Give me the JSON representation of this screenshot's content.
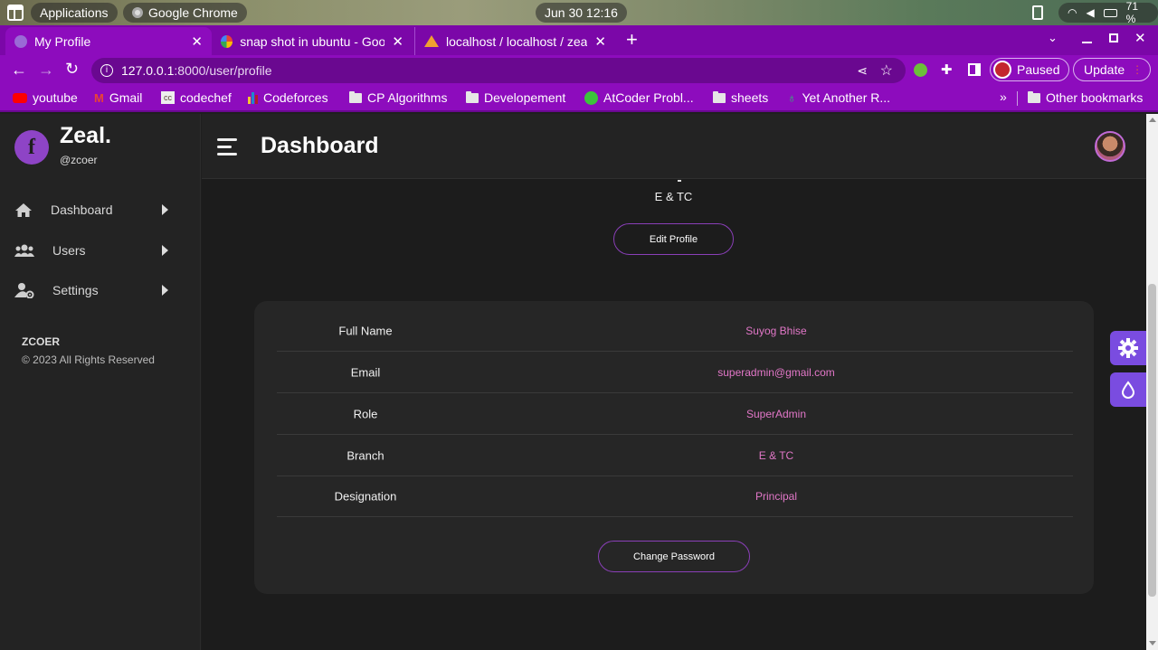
{
  "os": {
    "applications": "Applications",
    "active_app": "Google Chrome",
    "datetime": "Jun 30  12:16",
    "battery": "71 %"
  },
  "tabs": [
    {
      "title": "My Profile"
    },
    {
      "title": "snap shot in ubuntu - Goo"
    },
    {
      "title": "localhost / localhost / zea"
    }
  ],
  "toolbar": {
    "url_host": "127.0.0.1",
    "url_rest": ":8000/user/profile",
    "paused": "Paused",
    "update": "Update"
  },
  "bookmarks": [
    "youtube",
    "Gmail",
    "codechef",
    "Codeforces",
    "CP Algorithms",
    "Developement",
    "AtCoder Probl...",
    "sheets",
    "Yet Another R...",
    "Other bookmarks"
  ],
  "sidebar": {
    "brand": "Zeal.",
    "handle": "@zcoer",
    "items": [
      {
        "label": "Dashboard"
      },
      {
        "label": "Users"
      },
      {
        "label": "Settings"
      }
    ],
    "org": "ZCOER",
    "copyright": "© 2023 All Rights Reserved"
  },
  "header": {
    "title": "Dashboard"
  },
  "profile": {
    "branch_top": "E & TC",
    "edit_label": "Edit Profile",
    "change_password_label": "Change Password",
    "fields": [
      {
        "label": "Full Name",
        "value": "Suyog Bhise"
      },
      {
        "label": "Email",
        "value": "superadmin@gmail.com"
      },
      {
        "label": "Role",
        "value": "SuperAdmin"
      },
      {
        "label": "Branch",
        "value": "E & TC"
      },
      {
        "label": "Designation",
        "value": "Principal"
      }
    ]
  },
  "colors": {
    "chrome_purple": "#8d0cbd",
    "accent_pink": "#e277c8",
    "float_btn": "#7a4ce0"
  }
}
